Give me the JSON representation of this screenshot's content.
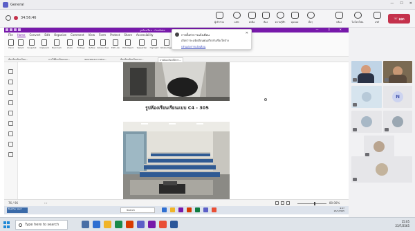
{
  "teams": {
    "window_title": "General",
    "timer": "34:56:46",
    "toolbar": [
      {
        "label": "ผู้เข้าร่วม",
        "icon": "people-icon"
      },
      {
        "label": "แชท",
        "icon": "chat-icon"
      },
      {
        "label": "ยกมือ",
        "icon": "raise-hand-icon"
      },
      {
        "label": "ห้อง",
        "icon": "rooms-icon"
      },
      {
        "label": "ความรู้สึก",
        "icon": "reactions-icon"
      },
      {
        "label": "มุมมอง",
        "icon": "view-icon"
      },
      {
        "label": "อื่นๆ",
        "icon": "more-icon"
      },
      {
        "label": "กล้อง",
        "icon": "camera-icon"
      },
      {
        "label": "ไมโครโฟน",
        "icon": "mic-icon"
      },
      {
        "label": "แชร์",
        "icon": "share-icon"
      }
    ],
    "leave_label": "ออก",
    "window_controls": [
      "—",
      "☐",
      "✕"
    ]
  },
  "onenote": {
    "title": "รูปห้องเรียน - OneNote",
    "menu": [
      "File",
      "Home",
      "Convert",
      "Edit",
      "Organize",
      "Comment",
      "View",
      "Form",
      "Protect",
      "Share",
      "Accessibility"
    ],
    "active_menu": "Home",
    "ribbon": [
      "Hand",
      "Select",
      "Snapshot",
      "Clipboard",
      "Bookmark",
      "Zoom",
      "Fit Page",
      "Reflow",
      "Rotate View",
      "Edit Link",
      "Edit Object",
      "Typewriter",
      "Highlight",
      "Rotate Pages"
    ],
    "sections": [
      "ห้องเรียนห้องเรียน...",
      "การใช้ห้องเรียนแบบ...",
      "ขอบเขตและการสอน...",
      "ห้องเรียนห้องเรียนรวม...",
      "ภาพห้องเรียนที่มีการ..."
    ],
    "caption": "รูปห้องเรียนเรียนแบบ C4 - 305",
    "status_page": "76 / 96",
    "zoom": "80.00%",
    "zoom_level": 0.58
  },
  "notification": {
    "title": "การตั้งค่าการแจ้งเตือน",
    "body": "เลือกว่าจะแจ้งเตือนคุณเกี่ยวกับเรื่องใดบ้าง",
    "link": "ปรับแต่งการแจ้งเตือน"
  },
  "participants": {
    "initial": "N"
  },
  "shared_taskbar": {
    "weather": "Weather alert",
    "search": "Search",
    "time": "4:07",
    "date": "23/7/2565"
  },
  "taskbar": {
    "search_placeholder": "Type here to search",
    "time": "15:05",
    "date": "23/7/2565"
  }
}
